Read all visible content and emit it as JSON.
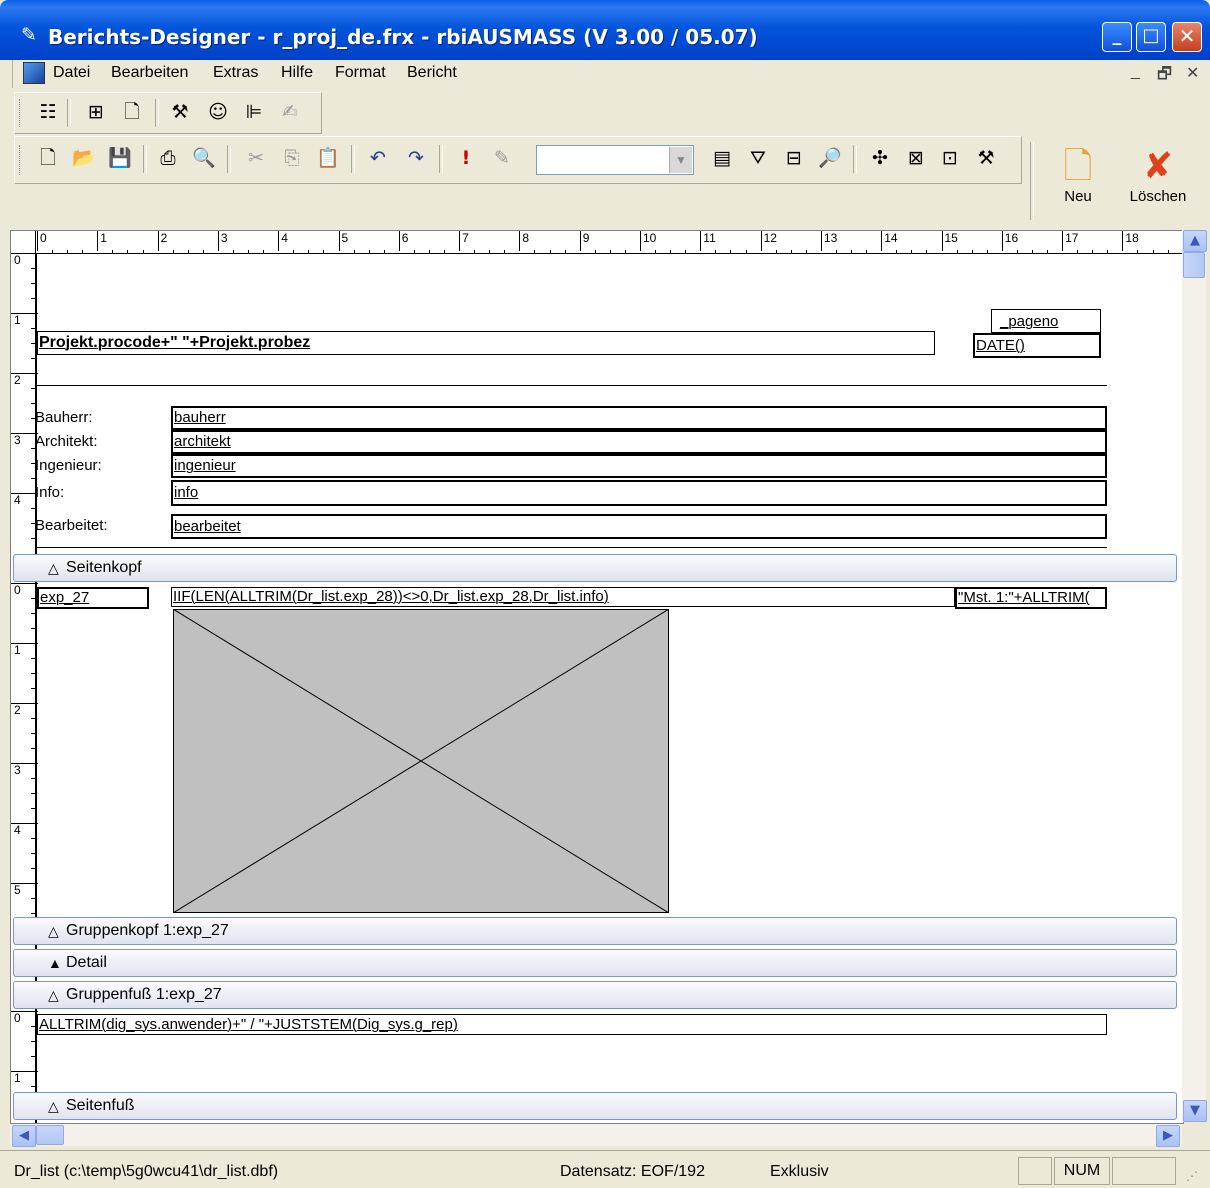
{
  "window": {
    "title": "Berichts-Designer - r_proj_de.frx - rbiAUSMASS (V 3.00 / 05.07)",
    "minimize_symbol": "_",
    "maximize_symbol": "□",
    "close_symbol": "✕"
  },
  "menu": {
    "items": [
      "Datei",
      "Bearbeiten",
      "Extras",
      "Hilfe",
      "Format",
      "Bericht"
    ],
    "mdi_minimize": "_",
    "mdi_restore": "🗗",
    "mdi_close": "✕"
  },
  "toolbar": {
    "combo_value": "",
    "new_label": "Neu",
    "delete_label": "Löschen"
  },
  "ruler": {
    "horizontal": [
      "0",
      "1",
      "2",
      "3",
      "4",
      "5",
      "6",
      "7",
      "8",
      "9",
      "10",
      "11",
      "12",
      "13",
      "14",
      "15",
      "16",
      "17",
      "18"
    ]
  },
  "report": {
    "page_header": {
      "band_label": "Seitenkopf",
      "vruler": [
        "0",
        "1",
        "2",
        "3",
        "4"
      ],
      "title_expr": "Projekt.procode+\" \"+Projekt.probez",
      "pageno": "_pageno",
      "date": "DATE()",
      "labels": {
        "bauherr": "Bauherr:",
        "architekt": "Architekt:",
        "ingenieur": "Ingenieur:",
        "info": "Info:",
        "bearbeitet": "Bearbeitet:"
      },
      "fields": {
        "bauherr": "bauherr",
        "architekt": "architekt",
        "ingenieur": "ingenieur",
        "info": "info",
        "bearbeitet": "bearbeitet"
      }
    },
    "group_header": {
      "band_label": "Gruppenkopf 1:exp_27",
      "vruler": [
        "0",
        "1",
        "2",
        "3",
        "4",
        "5"
      ],
      "exp_field": "exp_27",
      "iif_expr": "IIF(LEN(ALLTRIM(Dr_list.exp_28))<>0,Dr_list.exp_28,Dr_list.info)",
      "mst_expr": "\"Mst. 1:\"+ALLTRIM("
    },
    "detail": {
      "band_label": "Detail"
    },
    "group_footer": {
      "band_label": "Gruppenfuß 1:exp_27"
    },
    "page_footer": {
      "band_label": "Seitenfuß",
      "vruler": [
        "0",
        "1"
      ],
      "footer_expr": "ALLTRIM(dig_sys.anwender)+\" / \"+JUSTSTEM(Dig_sys.g_rep)"
    }
  },
  "status": {
    "table": "Dr_list (c:\\temp\\5g0wcu41\\dr_list.dbf)",
    "record": "Datensatz: EOF/192",
    "mode": "Exklusiv",
    "num": "NUM"
  }
}
